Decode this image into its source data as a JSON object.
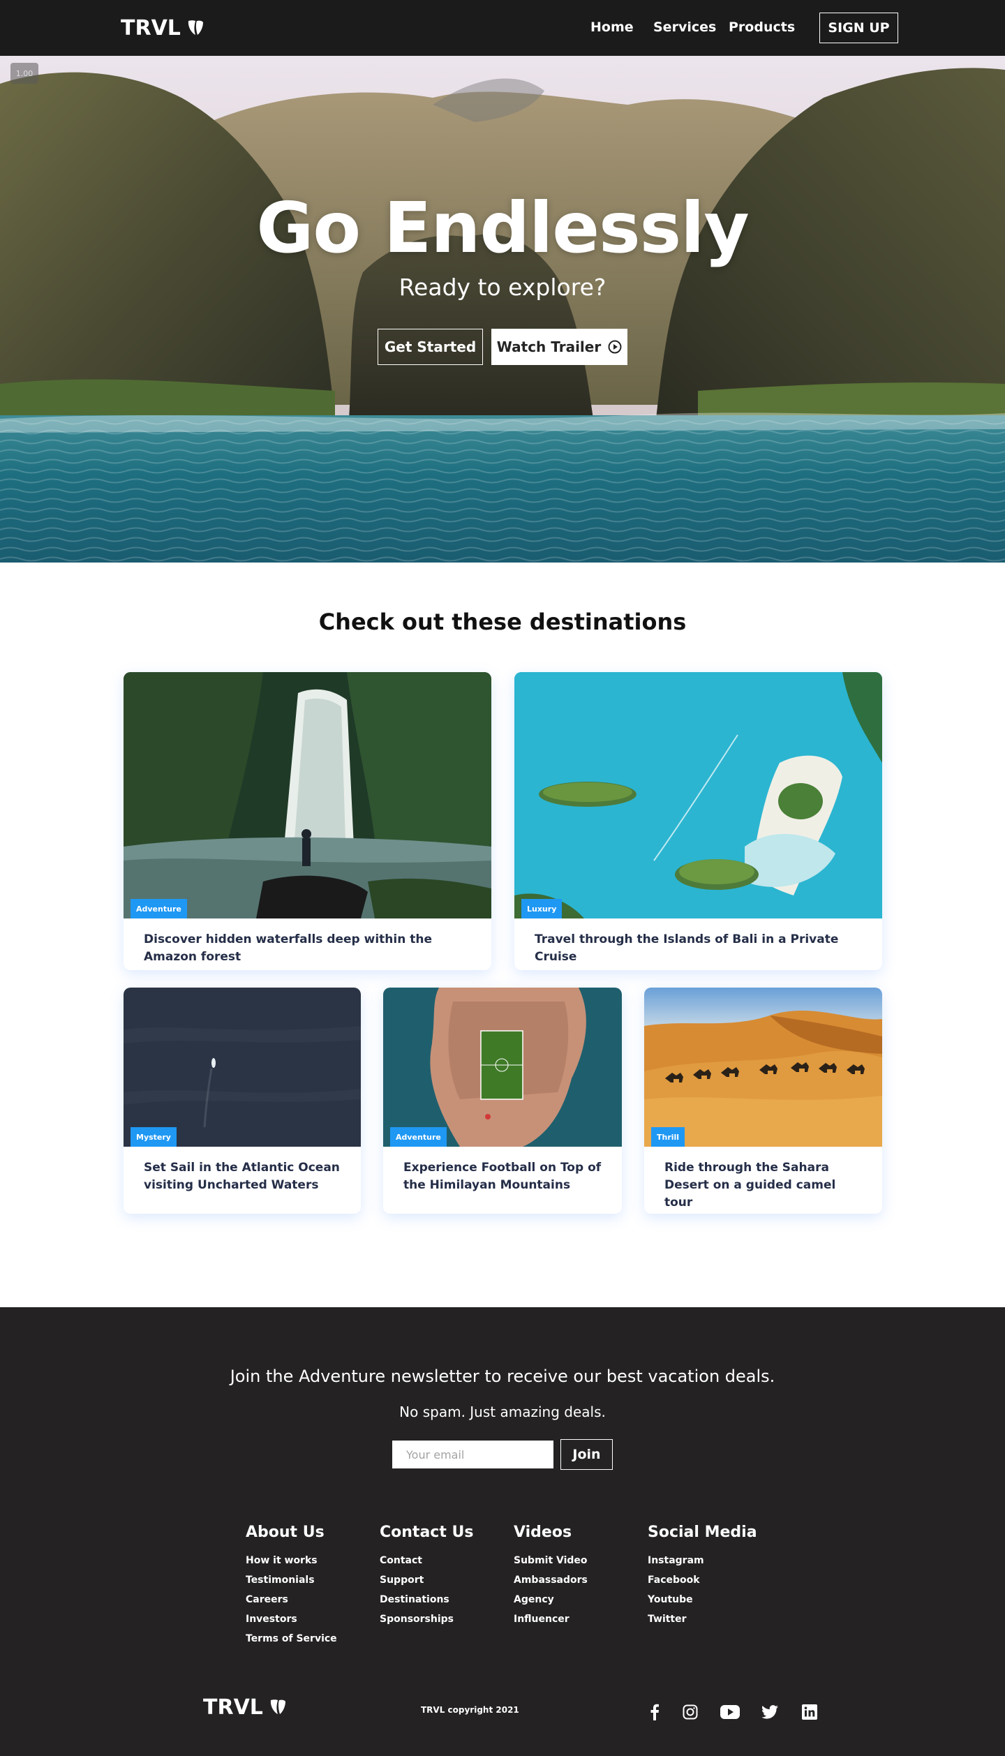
{
  "nav": {
    "logo_text": "TRVL",
    "logo_icon": "typo3-icon",
    "links": [
      "Home",
      "Services",
      "Products"
    ],
    "signup_label": "SIGN UP"
  },
  "hero": {
    "zoom_indicator": "1.00",
    "title": "Go Endlessly",
    "subtitle": "Ready to explore?",
    "primary_button": "Get Started",
    "secondary_button": "Watch Trailer",
    "secondary_icon": "play-circle-icon"
  },
  "destinations": {
    "heading": "Check out these destinations",
    "cards": [
      {
        "tag": "Adventure",
        "text": "Discover hidden waterfalls deep within the Amazon forest"
      },
      {
        "tag": "Luxury",
        "text": "Travel through the Islands of Bali in a Private Cruise"
      },
      {
        "tag": "Mystery",
        "text": "Set Sail in the Atlantic Ocean visiting Uncharted Waters"
      },
      {
        "tag": "Adventure",
        "text": "Experience Football on Top of the Himilayan Mountains"
      },
      {
        "tag": "Thrill",
        "text": "Ride through the Sahara Desert on a guided camel tour"
      }
    ]
  },
  "newsletter": {
    "heading": "Join the Adventure newsletter to receive our best vacation deals.",
    "subheading": "No spam. Just amazing deals.",
    "email_placeholder": "Your email",
    "join_label": "Join"
  },
  "footer": {
    "columns": [
      {
        "title": "About Us",
        "links": [
          "How it works",
          "Testimonials",
          "Careers",
          "Investors",
          "Terms of Service"
        ]
      },
      {
        "title": "Contact Us",
        "links": [
          "Contact",
          "Support",
          "Destinations",
          "Sponsorships"
        ]
      },
      {
        "title": "Videos",
        "links": [
          "Submit Video",
          "Ambassadors",
          "Agency",
          "Influencer"
        ]
      },
      {
        "title": "Social Media",
        "links": [
          "Instagram",
          "Facebook",
          "Youtube",
          "Twitter"
        ]
      }
    ],
    "logo_text": "TRVL",
    "copyright": "TRVL copyright 2021",
    "social_icons": [
      "facebook-icon",
      "instagram-icon",
      "youtube-icon",
      "twitter-icon",
      "linkedin-icon"
    ]
  },
  "colors": {
    "nav_bg": "#1c1b1b",
    "footer_bg": "#242222",
    "tag_bg": "#1f98f4",
    "caption_text": "#252e48"
  }
}
